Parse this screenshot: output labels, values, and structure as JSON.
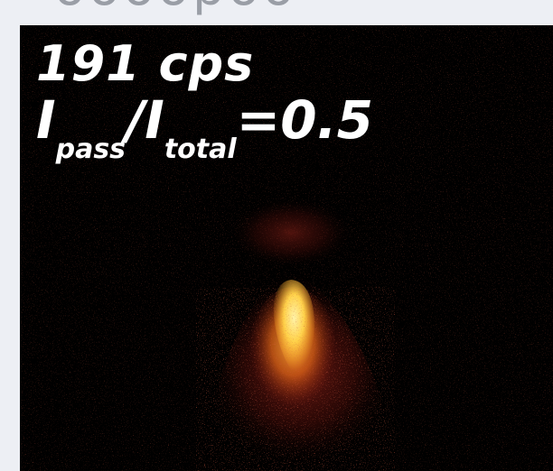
{
  "top_fragment": {
    "text": "oooopoo"
  },
  "image": {
    "count_rate": "191 cps",
    "ratio": {
      "numerator_symbol": "I",
      "numerator_subscript": "pass",
      "slash": "/",
      "denominator_symbol": "I",
      "denominator_subscript": "total",
      "equals_value": "=0.5"
    },
    "colors": {
      "background": "#000000",
      "hot_core": "#ffe27a",
      "mid": "#ff8c1a",
      "halo": "#b0201a"
    }
  }
}
